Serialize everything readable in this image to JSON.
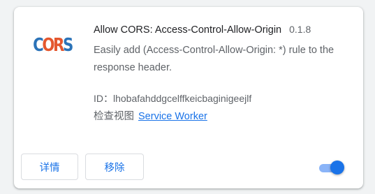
{
  "extension": {
    "logo_letters": [
      "C",
      "O",
      "R",
      "S"
    ],
    "name": "Allow CORS: Access-Control-Allow-Origin",
    "version": "0.1.8",
    "description": "Easily add (Access-Control-Allow-Origin: *) rule to the response header.",
    "id_label": "ID：",
    "id_value": "lhobafahddgcelffkeicbaginigeejlf",
    "inspect_label": "检查视图",
    "inspect_link": "Service Worker",
    "enabled": true
  },
  "buttons": {
    "details_label": "详情",
    "remove_label": "移除"
  },
  "colors": {
    "accent": "#1a73e8",
    "toggle_track": "#8ab4f8",
    "toggle_knob": "#1a73e8",
    "logo_blue": "#2b73b8",
    "logo_orange": "#e4572e"
  },
  "icons": {
    "logo": "cors-logo-icon",
    "toggle": "enable-toggle"
  }
}
